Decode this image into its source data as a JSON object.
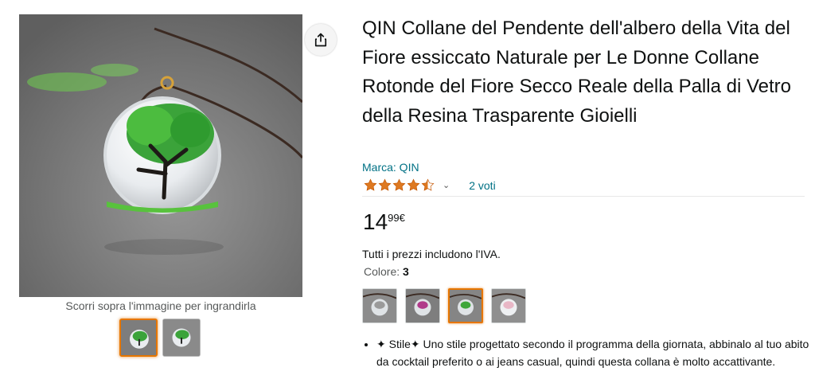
{
  "product": {
    "title": "QIN Collane del Pendente dell'albero della Vita del Fiore essiccato Naturale per Le Donne Collane Rotonde del Fiore Secco Reale della Palla di Vetro della Resina Trasparente Gioielli",
    "brand_label": "Marca: QIN",
    "rating": {
      "stars": 4.5,
      "chevron": "⌄",
      "votes_label": "2 voti"
    },
    "price": {
      "whole": "14",
      "fraction": "99",
      "currency": "€"
    },
    "vat_note": "Tutti i prezzi includono l'IVA.",
    "color": {
      "label": "Colore:",
      "value": "3"
    },
    "bullets": [
      "✦ Stile✦ Uno stile progettato secondo il programma della giornata, abbinalo al tuo abito da cocktail preferito o ai jeans casual, quindi questa collana è molto accattivante."
    ]
  },
  "gallery": {
    "zoom_hint": "Scorri sopra l'immagine per ingrandirla",
    "thumbnails": [
      {
        "selected": true,
        "icon": "tree-pendant-green"
      },
      {
        "selected": false,
        "icon": "tree-pendant-green"
      }
    ]
  },
  "swatches": [
    {
      "selected": false,
      "accent": "#9a9a9a"
    },
    {
      "selected": false,
      "accent": "#b03a8a"
    },
    {
      "selected": true,
      "accent": "#3fa63a"
    },
    {
      "selected": false,
      "accent": "#e8b7c6"
    }
  ],
  "icons": {
    "share": "share-icon",
    "star": "star-icon"
  },
  "colors": {
    "link": "#007185",
    "star": "#de7921",
    "selected_border": "#e77600"
  }
}
